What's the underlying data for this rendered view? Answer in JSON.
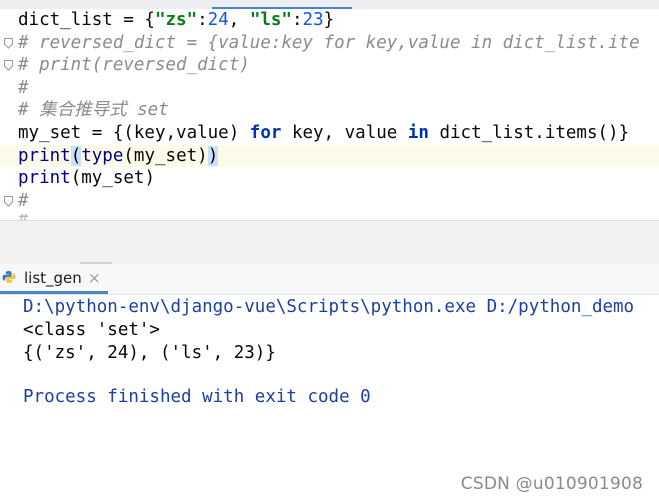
{
  "editor": {
    "lines": [
      {
        "kind": "plain",
        "parts": [
          {
            "c": "txt",
            "t": "dict_list = {"
          },
          {
            "c": "str",
            "t": "\"zs\""
          },
          {
            "c": "txt",
            "t": ":"
          },
          {
            "c": "num",
            "t": "24"
          },
          {
            "c": "txt",
            "t": ", "
          },
          {
            "c": "str",
            "t": "\"ls\""
          },
          {
            "c": "txt",
            "t": ":"
          },
          {
            "c": "num",
            "t": "23"
          },
          {
            "c": "txt",
            "t": "}"
          }
        ]
      },
      {
        "kind": "comment",
        "text": "# reversed_dict = {value:key for key,value in dict_list.ite"
      },
      {
        "kind": "comment",
        "text": "# print(reversed_dict)"
      },
      {
        "kind": "comment",
        "text": "#"
      },
      {
        "kind": "comment",
        "text": "# 集合推导式 set"
      },
      {
        "kind": "plain",
        "parts": [
          {
            "c": "txt",
            "t": "my_set = {(key,value) "
          },
          {
            "c": "kw",
            "t": "for"
          },
          {
            "c": "txt",
            "t": " key, value "
          },
          {
            "c": "kw",
            "t": "in"
          },
          {
            "c": "txt",
            "t": " dict_list.items()}"
          }
        ]
      },
      {
        "kind": "current",
        "parts": [
          {
            "c": "bi",
            "t": "print"
          },
          {
            "c": "brace-hl",
            "t": "("
          },
          {
            "c": "bi",
            "t": "type"
          },
          {
            "c": "txt",
            "t": "(my_set)"
          },
          {
            "c": "brace-hl",
            "t": ")"
          }
        ]
      },
      {
        "kind": "plain",
        "parts": [
          {
            "c": "bi",
            "t": "print"
          },
          {
            "c": "txt",
            "t": "(my_set)"
          }
        ]
      },
      {
        "kind": "comment",
        "text": "#"
      }
    ],
    "ghost_text": "#"
  },
  "run_panel": {
    "tab_label": "list_gen",
    "close_glyph": "×"
  },
  "console": {
    "command": "D:\\python-env\\django-vue\\Scripts\\python.exe D:/python_demo",
    "output_1": "<class 'set'>",
    "output_2": "{('zs', 24), ('ls', 23)}",
    "exit_message": "Process finished with exit code 0"
  },
  "watermark": "CSDN @u010901908",
  "colors": {
    "keyword": "#0033b3",
    "string": "#067d17",
    "number": "#1750eb",
    "comment": "#8c8c8c",
    "console_blue": "#1b3fa6",
    "current_line": "#fcfae8"
  }
}
